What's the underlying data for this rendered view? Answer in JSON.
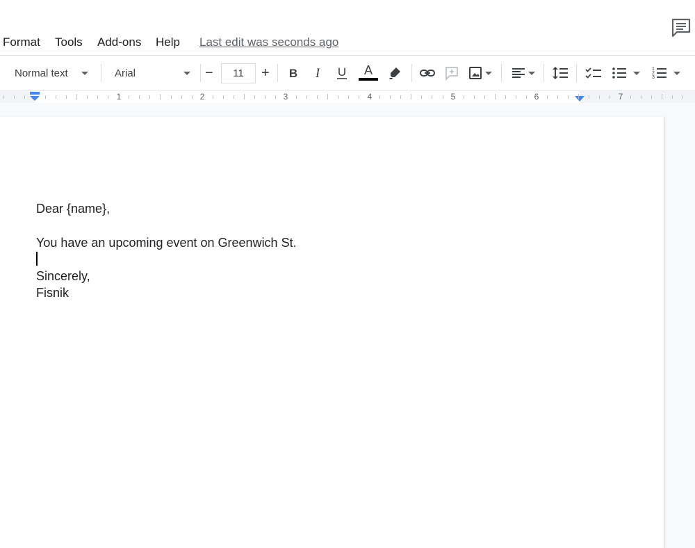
{
  "menu": {
    "items": [
      "Format",
      "Tools",
      "Add-ons",
      "Help"
    ],
    "last_edit": "Last edit was seconds ago"
  },
  "toolbar": {
    "style_label": "Normal text",
    "font_label": "Arial",
    "font_size": "11",
    "minus": "−",
    "plus": "+",
    "text_color": "#000000"
  },
  "ruler": {
    "numbers": [
      "1",
      "2",
      "3",
      "4",
      "5",
      "6",
      "7"
    ]
  },
  "document": {
    "lines": [
      "Dear {name},",
      "You have an upcoming event on Greenwich St.",
      "Sincerely,",
      "Fisnik"
    ]
  },
  "icons": {
    "comment": "comment-icon",
    "bold": "bold-icon",
    "italic": "italic-icon",
    "underline": "underline-icon"
  }
}
